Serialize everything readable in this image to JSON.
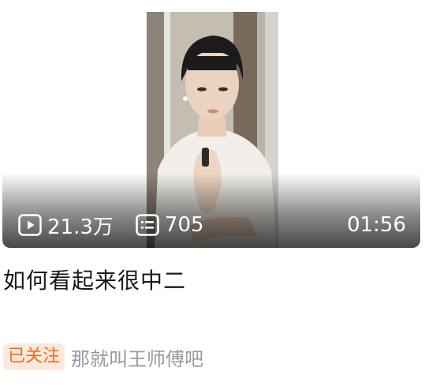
{
  "video": {
    "play_count": "21.3万",
    "danmaku_count": "705",
    "duration": "01:56"
  },
  "title": "如何看起来很中二",
  "follow_badge": "已关注",
  "author": "那就叫王师傅吧",
  "icons": {
    "play": "play-icon",
    "danmaku": "danmaku-icon"
  },
  "colors": {
    "badge_bg": "#fde9dc",
    "badge_text": "#f06a1e",
    "author_text": "#9a9a9a",
    "title_text": "#1a1a1a"
  }
}
